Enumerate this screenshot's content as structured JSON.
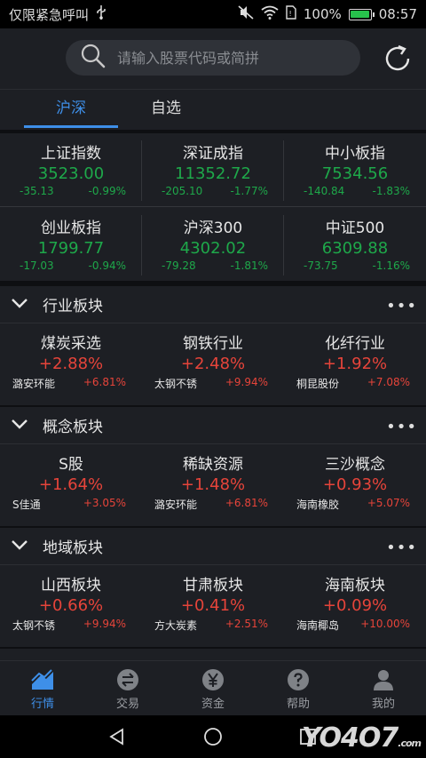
{
  "status_bar": {
    "carrier": "仅限紧急呼叫",
    "battery": "100%",
    "battery_level": 1.0,
    "time": "08:57"
  },
  "search": {
    "placeholder": "请输入股票代码或简拼"
  },
  "tabs": [
    {
      "label": "沪深"
    },
    {
      "label": "自选"
    }
  ],
  "indices": [
    {
      "name": "上证指数",
      "value": "3523.00",
      "change": "-35.13",
      "pct": "-0.99%"
    },
    {
      "name": "深证成指",
      "value": "11352.72",
      "change": "-205.10",
      "pct": "-1.77%"
    },
    {
      "name": "中小板指",
      "value": "7534.56",
      "change": "-140.84",
      "pct": "-1.83%"
    },
    {
      "name": "创业板指",
      "value": "1799.77",
      "change": "-17.03",
      "pct": "-0.94%"
    },
    {
      "name": "沪深300",
      "value": "4302.02",
      "change": "-79.28",
      "pct": "-1.81%"
    },
    {
      "name": "中证500",
      "value": "6309.88",
      "change": "-73.75",
      "pct": "-1.16%"
    }
  ],
  "sections": [
    {
      "title": "行业板块",
      "more": "•••",
      "items": [
        {
          "name": "煤炭采选",
          "pct": "+2.88%",
          "lead": "潞安环能",
          "lead_pct": "+6.81%"
        },
        {
          "name": "钢铁行业",
          "pct": "+2.48%",
          "lead": "太钢不锈",
          "lead_pct": "+9.94%"
        },
        {
          "name": "化纤行业",
          "pct": "+1.92%",
          "lead": "桐昆股份",
          "lead_pct": "+7.08%"
        }
      ]
    },
    {
      "title": "概念板块",
      "more": "•••",
      "items": [
        {
          "name": "S股",
          "pct": "+1.64%",
          "lead": "S佳通",
          "lead_pct": "+3.05%"
        },
        {
          "name": "稀缺资源",
          "pct": "+1.48%",
          "lead": "潞安环能",
          "lead_pct": "+6.81%"
        },
        {
          "name": "三沙概念",
          "pct": "+0.93%",
          "lead": "海南橡胶",
          "lead_pct": "+5.07%"
        }
      ]
    },
    {
      "title": "地域板块",
      "more": "•••",
      "items": [
        {
          "name": "山西板块",
          "pct": "+0.66%",
          "lead": "太钢不锈",
          "lead_pct": "+9.94%"
        },
        {
          "name": "甘肃板块",
          "pct": "+0.41%",
          "lead": "方大炭素",
          "lead_pct": "+2.51%"
        },
        {
          "name": "海南板块",
          "pct": "+0.09%",
          "lead": "海南椰岛",
          "lead_pct": "+10.00%"
        }
      ]
    }
  ],
  "bottom_nav": [
    {
      "label": "行情",
      "icon": "chart-icon"
    },
    {
      "label": "交易",
      "icon": "exchange-icon"
    },
    {
      "label": "资金",
      "icon": "yuan-icon"
    },
    {
      "label": "帮助",
      "icon": "help-icon"
    },
    {
      "label": "我的",
      "icon": "user-icon"
    }
  ],
  "watermark": {
    "main": "YO4O7",
    "suffix": ".com"
  },
  "colors": {
    "accent": "#3e8fe8",
    "up": "#e6443a",
    "down": "#1ea84a",
    "panel": "#1d1f24"
  }
}
